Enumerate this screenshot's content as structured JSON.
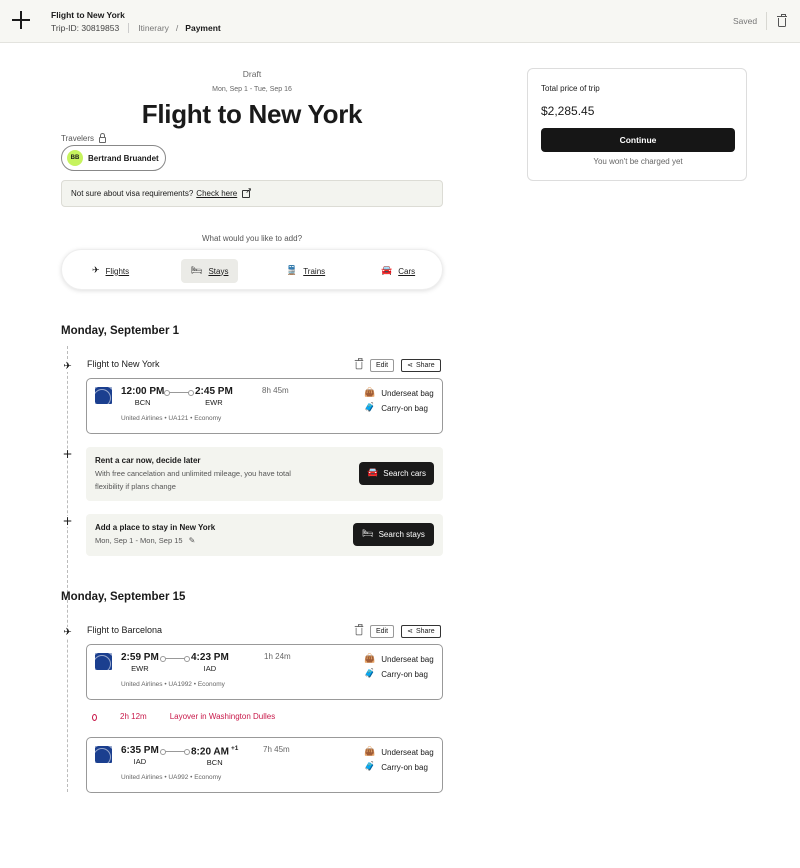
{
  "topbar": {
    "title": "Flight to New York",
    "trip_id": "Trip-ID: 30819853",
    "crumb_itinerary": "Itinerary",
    "crumb_separator": "/",
    "crumb_payment": "Payment",
    "saved": "Saved"
  },
  "header": {
    "status": "Draft",
    "dates": "Mon, Sep 1 - Tue, Sep 16",
    "title": "Flight to New York"
  },
  "travelers": {
    "label": "Travelers",
    "items": [
      {
        "initials": "BB",
        "name": "Bertrand Bruandet"
      }
    ]
  },
  "visa": {
    "text": "Not sure about visa requirements?",
    "link": "Check here"
  },
  "add": {
    "question": "What would you like to add?",
    "options": [
      {
        "label": "Flights",
        "icon": "plane-icon"
      },
      {
        "label": "Stays",
        "icon": "bed-icon",
        "active": true
      },
      {
        "label": "Trains",
        "icon": "train-icon"
      },
      {
        "label": "Cars",
        "icon": "car-icon"
      }
    ]
  },
  "days": [
    {
      "label": "Monday, September 1"
    },
    {
      "label": "Monday, September 15"
    }
  ],
  "actions": {
    "edit": "Edit",
    "share": "Share"
  },
  "segments": [
    {
      "title": "Flight to New York",
      "legs": [
        {
          "dep_time": "12:00 PM",
          "dep_code": "BCN",
          "arr_time": "2:45 PM",
          "arr_code": "EWR",
          "arr_offset": "",
          "duration": "8h 45m",
          "info": "United Airlines • UA121 • Economy"
        }
      ]
    },
    {
      "title": "Flight to Barcelona",
      "legs": [
        {
          "dep_time": "2:59 PM",
          "dep_code": "EWR",
          "arr_time": "4:23 PM",
          "arr_code": "IAD",
          "arr_offset": "",
          "duration": "1h 24m",
          "info": "United Airlines • UA1992 • Economy"
        },
        {
          "dep_time": "6:35 PM",
          "dep_code": "IAD",
          "arr_time": "8:20 AM",
          "arr_code": "BCN",
          "arr_offset": "+1",
          "duration": "7h 45m",
          "info": "United Airlines • UA992 • Economy"
        }
      ],
      "layover": {
        "duration": "2h 12m",
        "text": "Layover in Washington Dulles"
      }
    }
  ],
  "bags": {
    "underseat": "Underseat bag",
    "carryon": "Carry-on bag"
  },
  "car_promo": {
    "heading": "Rent a car now, decide later",
    "line1": "With free cancelation and unlimited mileage, you have total",
    "line2": "flexibility if plans change",
    "button": "Search cars"
  },
  "stay_promo": {
    "heading": "Add a place to stay in New York",
    "dates": "Mon, Sep 1 - Mon, Sep 15",
    "button": "Search stays"
  },
  "price": {
    "label": "Total price of trip",
    "value": "$2,285.45",
    "button": "Continue",
    "note": "You won't be charged yet"
  },
  "colors": {
    "accent": "#c6f35e",
    "layover": "#c8194a",
    "dark": "#161616",
    "airline": "#1b3f8f"
  }
}
